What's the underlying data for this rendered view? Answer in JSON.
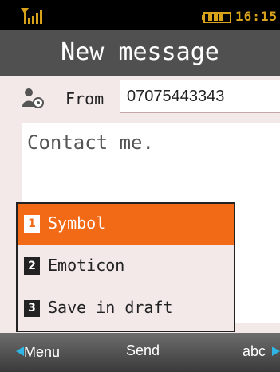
{
  "status": {
    "clock": "16:15",
    "signal_icon": "signal-icon",
    "battery_icon": "battery-icon"
  },
  "header": {
    "title": "New message"
  },
  "compose": {
    "from_label": "From",
    "from_value": "07075443343",
    "body_text": "Contact me."
  },
  "options_menu": {
    "items": [
      {
        "number": "1",
        "label": "Symbol",
        "selected": true
      },
      {
        "number": "2",
        "label": "Emoticon",
        "selected": false
      },
      {
        "number": "3",
        "label": "Save in draft",
        "selected": false
      }
    ]
  },
  "softkeys": {
    "left": "Menu",
    "center": "Send",
    "right": "abc"
  },
  "colors": {
    "accent": "#f36a16",
    "softkey_marker": "#2fb6e6",
    "clock": "#d8a21a"
  }
}
